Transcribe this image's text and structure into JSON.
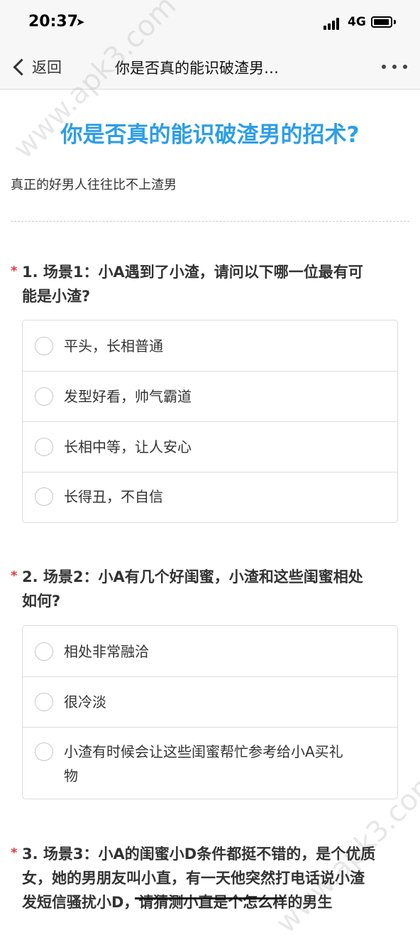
{
  "status_bar": {
    "time": "20:37",
    "location_icon": "location-arrow-icon",
    "network": "4G",
    "signal_icon": "signal-bars-icon",
    "battery_icon": "battery-icon"
  },
  "nav": {
    "back_label": "返回",
    "title": "你是否真的能识破渣男…",
    "more_icon": "more-dots-icon"
  },
  "watermark": "www.apk3.com",
  "survey": {
    "title": "你是否真的能识破渣男的招术?",
    "description": "真正的好男人往往比不上渣男"
  },
  "questions": [
    {
      "required_mark": "*",
      "line1": "1. 场景1：小A遇到了小渣，请问以下哪一位最有可",
      "line2": "能是小渣?",
      "options": [
        "平头，长相普通",
        "发型好看，帅气霸道",
        "长相中等，让人安心",
        "长得丑，不自信"
      ]
    },
    {
      "required_mark": "*",
      "line1": "2. 场景2：小A有几个好闺蜜，小渣和这些闺蜜相处",
      "line2": "如何?",
      "options": [
        "相处非常融洽",
        "很冷淡",
        "小渣有时候会让这些闺蜜帮忙参考给小A买礼",
        "物"
      ]
    },
    {
      "required_mark": "*",
      "line1": "3. 场景3：小A的闺蜜小D条件都挺不错的，是个优质",
      "line2": "女，她的男朋友叫小直，有一天他突然打电话说小渣",
      "line3": "发短信骚扰小D，请猜测小直是个怎么样的男生"
    }
  ],
  "colors": {
    "title_blue": "#2d9ee8",
    "required_red": "#e53935",
    "bar_bg": "#f7f7f7",
    "border": "#dcdcdc"
  }
}
